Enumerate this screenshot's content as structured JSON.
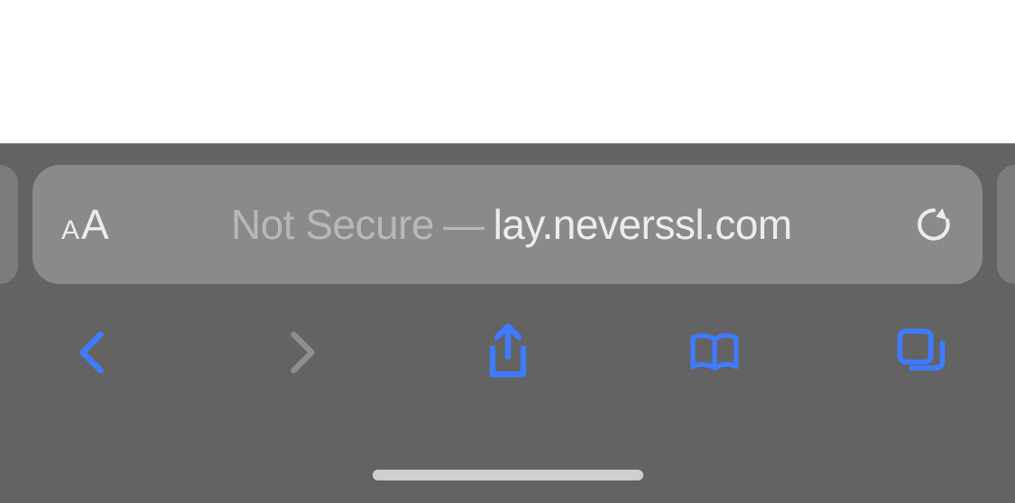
{
  "addressBar": {
    "aaLabel": "AA",
    "securityLabel": "Not Secure",
    "separator": "—",
    "urlVisible": "lay.neverssl.com"
  },
  "icons": {
    "reload": "reload-icon",
    "back": "back-icon",
    "forward": "forward-icon",
    "share": "share-icon",
    "bookmarks": "bookmarks-icon",
    "tabs": "tabs-icon"
  },
  "colors": {
    "accent": "#3f7bff",
    "disabled": "#8e8e8e",
    "chrome": "#636363",
    "barFill": "#8a8a8a",
    "textPrimary": "#ececec",
    "textSecondary": "#b8b8b8"
  },
  "toolbar": {
    "backEnabled": true,
    "forwardEnabled": false
  }
}
